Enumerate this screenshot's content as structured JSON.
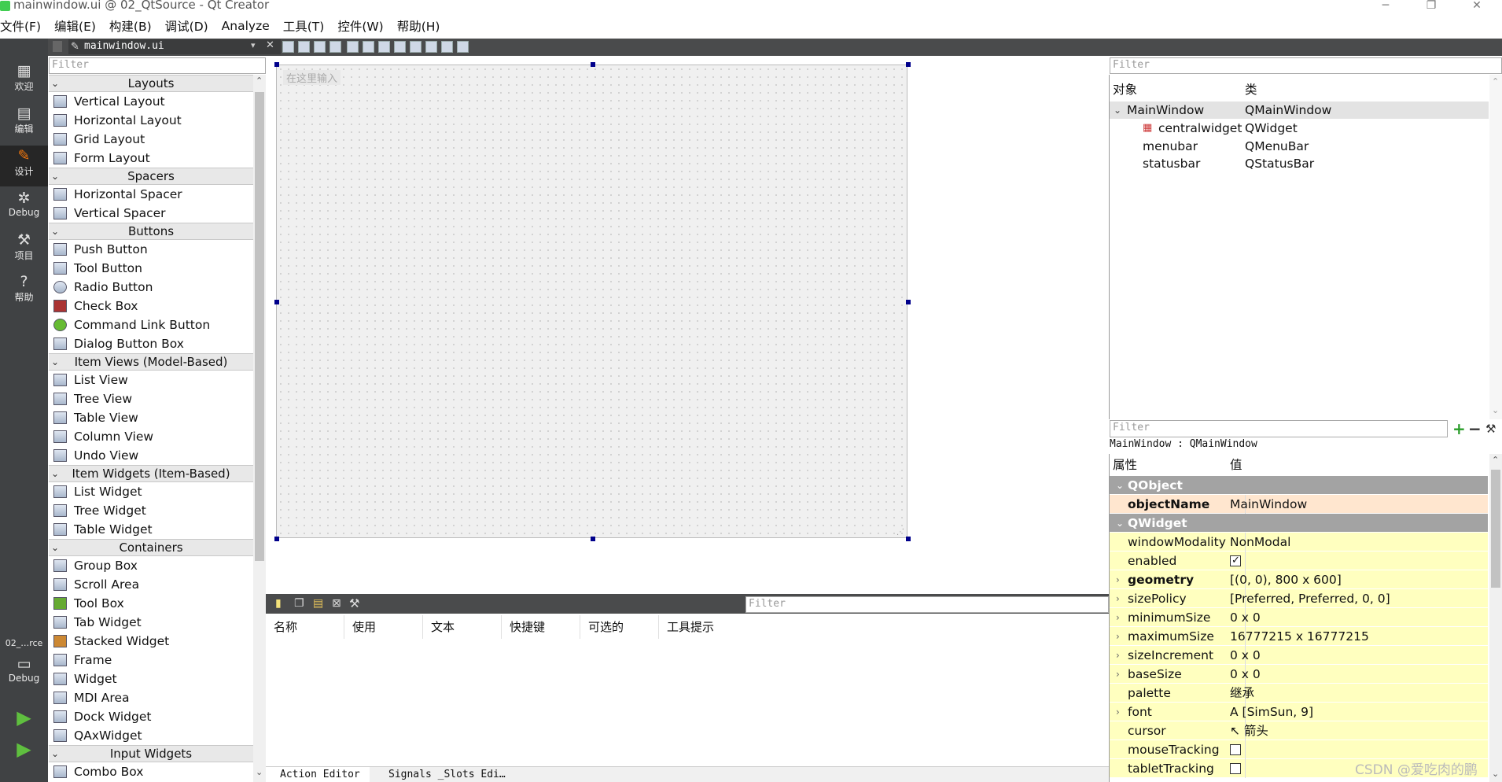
{
  "window": {
    "title": "mainwindow.ui @ 02_QtSource - Qt Creator"
  },
  "menu": [
    "文件(F)",
    "编辑(E)",
    "构建(B)",
    "调试(D)",
    "Analyze",
    "工具(T)",
    "控件(W)",
    "帮助(H)"
  ],
  "modes": [
    {
      "label": "欢迎",
      "icon": "grid-icon"
    },
    {
      "label": "编辑",
      "icon": "document-icon"
    },
    {
      "label": "设计",
      "icon": "pencil-icon"
    },
    {
      "label": "Debug",
      "icon": "bug-icon"
    },
    {
      "label": "项目",
      "icon": "wrench-icon"
    },
    {
      "label": "帮助",
      "icon": "help-icon"
    }
  ],
  "kit": {
    "project": "02_…rce",
    "label": "Debug"
  },
  "editor": {
    "file_tab": "mainwindow.ui"
  },
  "widgetbox": {
    "filter_placeholder": "Filter",
    "categories": [
      {
        "name": "Layouts",
        "items": [
          "Vertical Layout",
          "Horizontal Layout",
          "Grid Layout",
          "Form Layout"
        ]
      },
      {
        "name": "Spacers",
        "items": [
          "Horizontal Spacer",
          "Vertical Spacer"
        ]
      },
      {
        "name": "Buttons",
        "items": [
          "Push Button",
          "Tool Button",
          "Radio Button",
          "Check Box",
          "Command Link Button",
          "Dialog Button Box"
        ]
      },
      {
        "name": "Item Views (Model-Based)",
        "items": [
          "List View",
          "Tree View",
          "Table View",
          "Column View",
          "Undo View"
        ]
      },
      {
        "name": "Item Widgets (Item-Based)",
        "items": [
          "List Widget",
          "Tree Widget",
          "Table Widget"
        ]
      },
      {
        "name": "Containers",
        "items": [
          "Group Box",
          "Scroll Area",
          "Tool Box",
          "Tab Widget",
          "Stacked Widget",
          "Frame",
          "Widget",
          "MDI Area",
          "Dock Widget",
          "QAxWidget"
        ]
      },
      {
        "name": "Input Widgets",
        "items": [
          "Combo Box"
        ]
      }
    ]
  },
  "form": {
    "menu_placeholder": "在这里输入"
  },
  "action_editor": {
    "filter_placeholder": "Filter",
    "columns": [
      "名称",
      "使用",
      "文本",
      "快捷键",
      "可选的",
      "工具提示"
    ],
    "tabs": [
      "Action Editor",
      "Signals _Slots Edi…"
    ]
  },
  "object_inspector": {
    "filter_placeholder": "Filter",
    "headers": [
      "对象",
      "类"
    ],
    "rows": [
      {
        "object": "MainWindow",
        "class": "QMainWindow"
      },
      {
        "object": "centralwidget",
        "class": "QWidget"
      },
      {
        "object": "menubar",
        "class": "QMenuBar"
      },
      {
        "object": "statusbar",
        "class": "QStatusBar"
      }
    ]
  },
  "property_editor": {
    "filter_placeholder": "Filter",
    "class_label": "MainWindow : QMainWindow",
    "headers": [
      "属性",
      "值"
    ],
    "groups": [
      {
        "name": "QObject",
        "props": [
          {
            "name": "objectName",
            "value": "MainWindow"
          }
        ]
      },
      {
        "name": "QWidget",
        "props": [
          {
            "name": "windowModality",
            "value": "NonModal"
          },
          {
            "name": "enabled",
            "value": "",
            "checked": true
          },
          {
            "name": "geometry",
            "value": "[(0, 0), 800 x 600]"
          },
          {
            "name": "sizePolicy",
            "value": "[Preferred, Preferred, 0, 0]"
          },
          {
            "name": "minimumSize",
            "value": "0 x 0"
          },
          {
            "name": "maximumSize",
            "value": "16777215 x 16777215"
          },
          {
            "name": "sizeIncrement",
            "value": "0 x 0"
          },
          {
            "name": "baseSize",
            "value": "0 x 0"
          },
          {
            "name": "palette",
            "value": "继承"
          },
          {
            "name": "font",
            "value": "[SimSun, 9]"
          },
          {
            "name": "cursor",
            "value": "箭头"
          },
          {
            "name": "mouseTracking",
            "value": "",
            "checked": false
          },
          {
            "name": "tabletTracking",
            "value": "",
            "checked": false
          }
        ]
      }
    ]
  },
  "watermark": "CSDN @爱吃肉的鹏"
}
